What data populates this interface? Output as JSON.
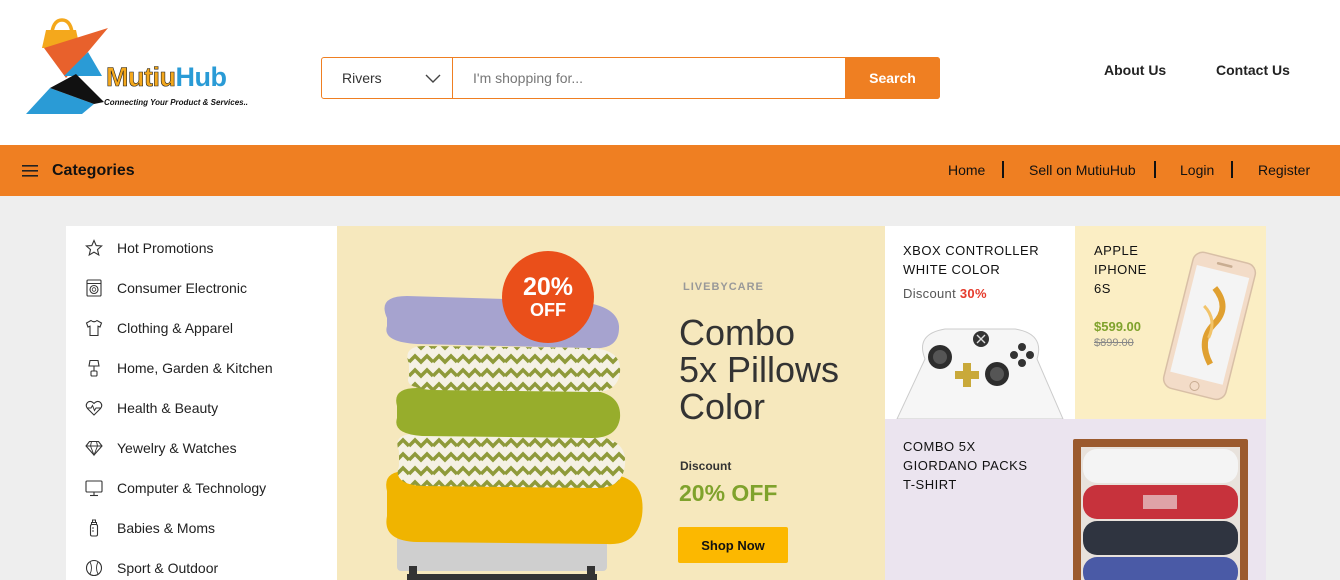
{
  "brand": {
    "name_part1": "Mutiu",
    "name_part2": "Hub",
    "tagline": "Connecting Your Product & Services.."
  },
  "search": {
    "location": "Rivers",
    "placeholder": "I'm shopping for...",
    "button_label": "Search"
  },
  "top_links": {
    "about": "About Us",
    "contact": "Contact Us"
  },
  "navbar": {
    "categories_label": "Categories",
    "links": [
      "Home",
      "Sell on MutiuHub",
      "Login",
      "Register"
    ]
  },
  "sidebar": {
    "items": [
      {
        "label": "Hot Promotions",
        "icon": "star-icon"
      },
      {
        "label": "Consumer Electronic",
        "icon": "washing-machine-icon"
      },
      {
        "label": "Clothing & Apparel",
        "icon": "tshirt-icon"
      },
      {
        "label": "Home, Garden & Kitchen",
        "icon": "lamp-icon"
      },
      {
        "label": "Health & Beauty",
        "icon": "heartbeat-icon"
      },
      {
        "label": "Yewelry & Watches",
        "icon": "diamond-icon"
      },
      {
        "label": "Computer & Technology",
        "icon": "monitor-icon"
      },
      {
        "label": "Babies & Moms",
        "icon": "baby-bottle-icon"
      },
      {
        "label": "Sport & Outdoor",
        "icon": "ball-icon"
      }
    ]
  },
  "banner": {
    "badge_pct": "20%",
    "badge_off": "OFF",
    "brand": "LIVEBYCARE",
    "title_line1": "Combo",
    "title_line2": "5x Pillows",
    "title_line3": "Color",
    "discount_label": "Discount",
    "discount_value": "20% OFF",
    "button_label": "Shop Now",
    "colors": {
      "background": "#f6e8bd",
      "badge": "#ea4f1a",
      "discount": "#7fa22c",
      "button": "#fcb800"
    }
  },
  "cards": {
    "xbox": {
      "title_line1": "XBOX CONTROLLER",
      "title_line2": "WHITE COLOR",
      "discount_label": "Discount",
      "discount_value": "30%"
    },
    "iphone": {
      "title_line1": "APPLE",
      "title_line2": "IPHONE",
      "title_line3": "6S",
      "price": "$599.00",
      "old_price": "$899.00"
    },
    "tshirt": {
      "title_line1": "COMBO 5X",
      "title_line2": "GIORDANO PACKS",
      "title_line3": "T-SHIRT"
    }
  },
  "theme": {
    "accent": "#ef7f22",
    "page_bg": "#eeeeee"
  }
}
